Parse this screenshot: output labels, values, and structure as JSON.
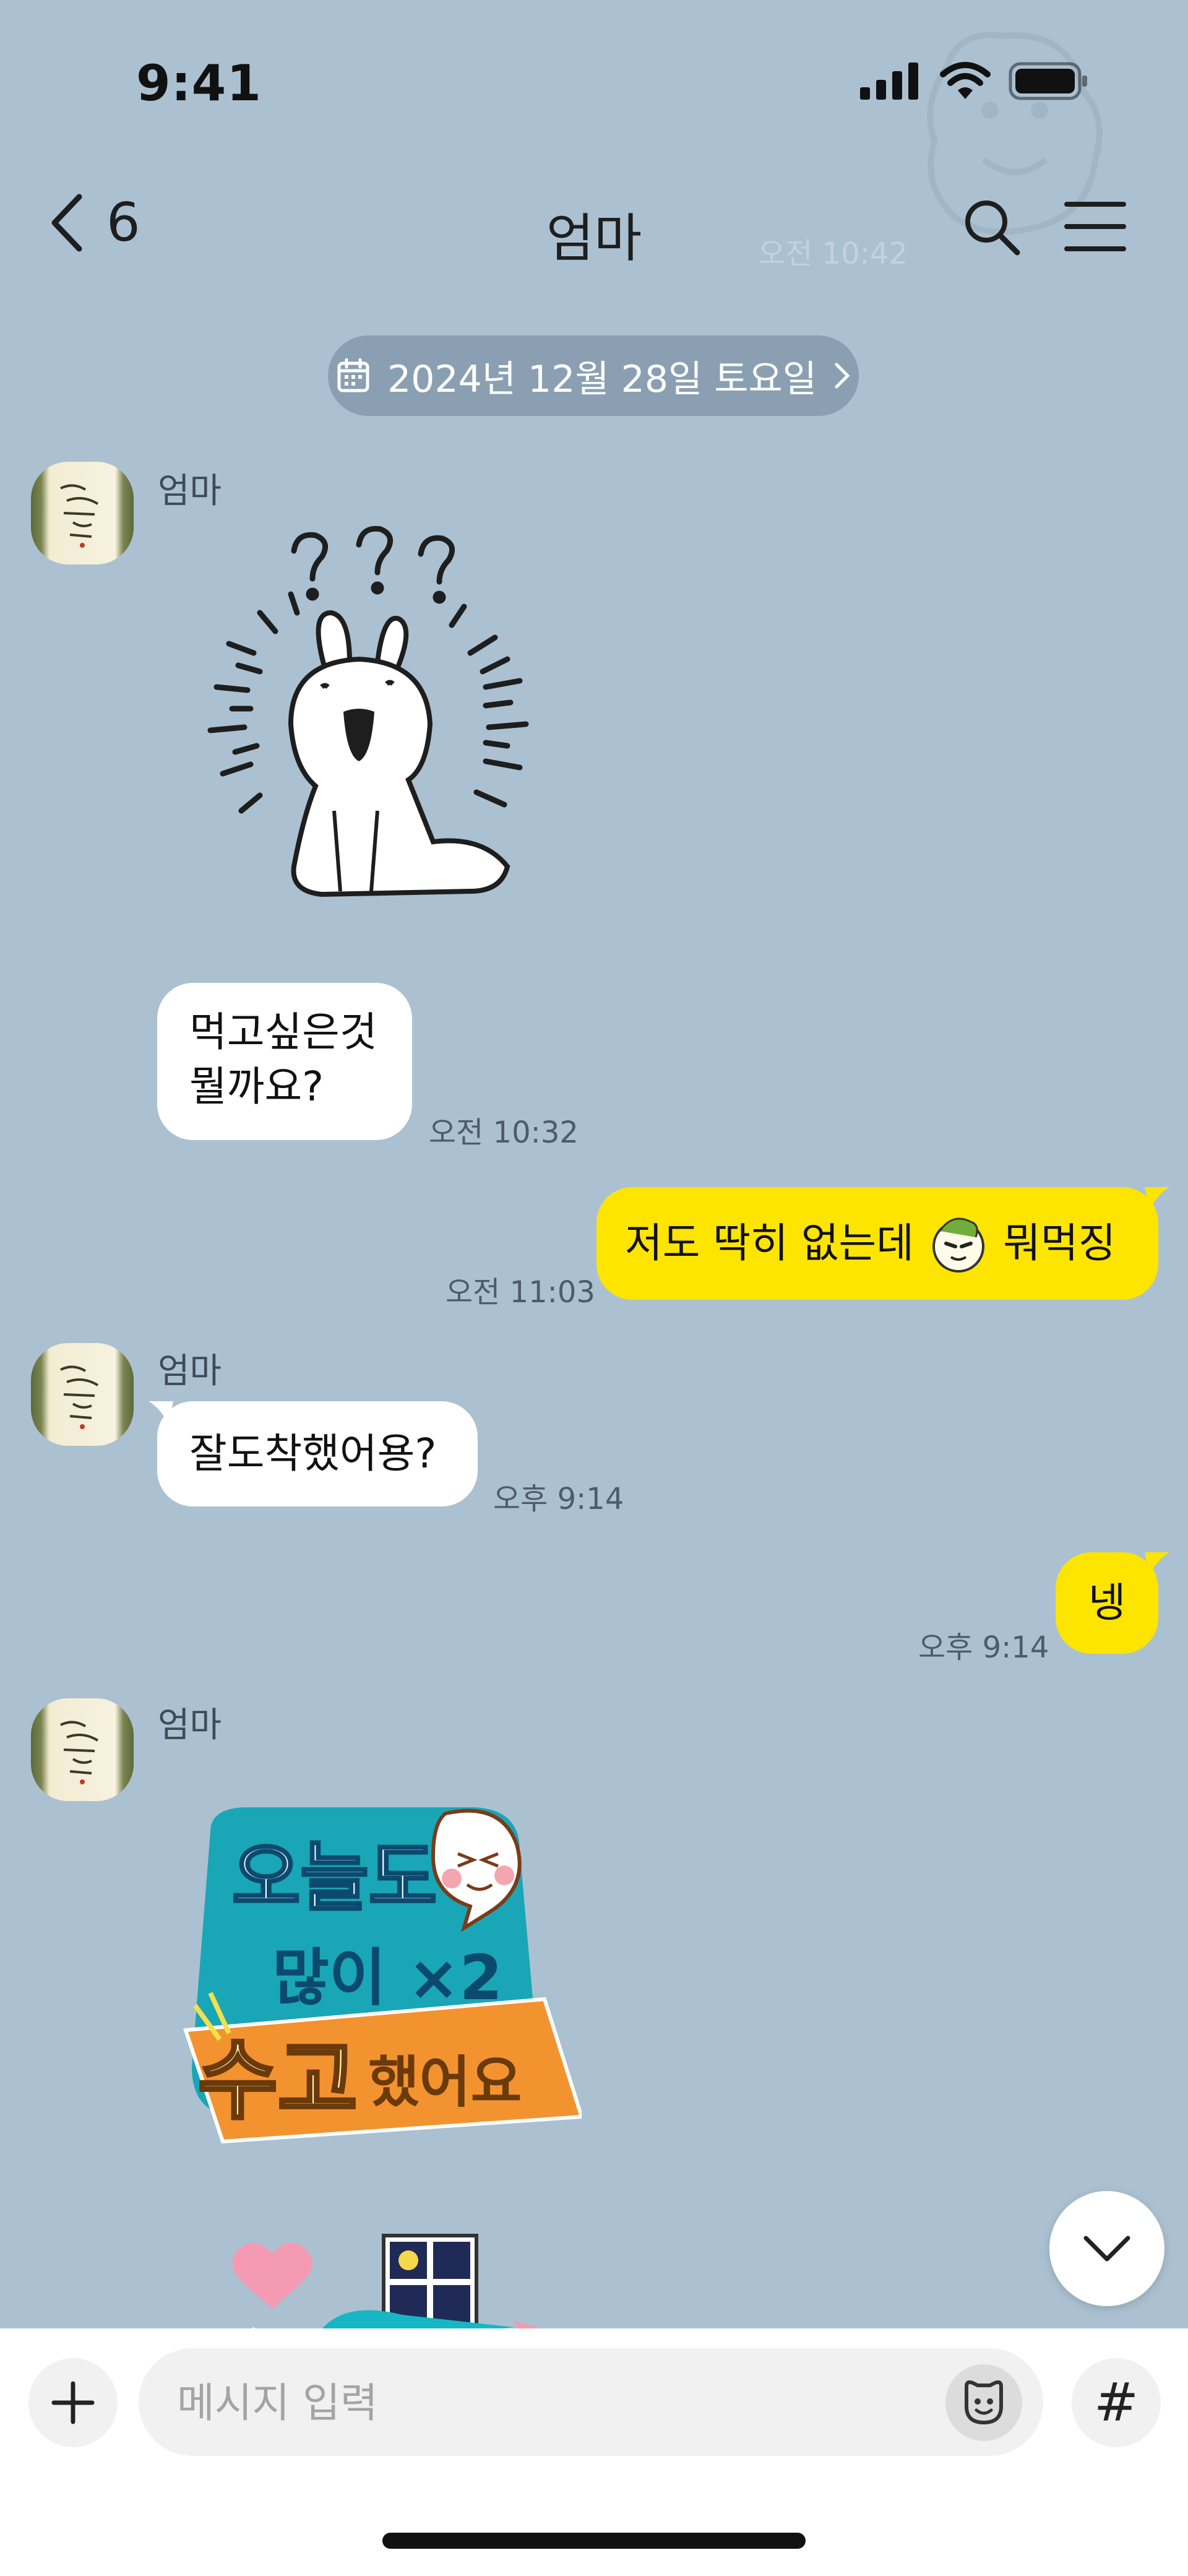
{
  "status": {
    "time": "9:41"
  },
  "header": {
    "back_count": "6",
    "title": "엄마",
    "ghost_time": "오전 10:42"
  },
  "date_separator": {
    "label": "2024년 12월 28일 토요일"
  },
  "messages": [
    {
      "type": "sender",
      "name": "엄마"
    },
    {
      "type": "text_in",
      "text_line1": "먹고싶은것",
      "text_line2": "뭘까요?",
      "time": "오전 10:32"
    },
    {
      "type": "text_out",
      "text_before": "저도 딱히 없는데",
      "text_after": "뭐먹징",
      "time": "오전 11:03"
    },
    {
      "type": "sender",
      "name": "엄마"
    },
    {
      "type": "text_in",
      "text": "잘도착했어용?",
      "time": "오후 9:14"
    },
    {
      "type": "text_out",
      "text": "넹",
      "time": "오후 9:14"
    },
    {
      "type": "sender",
      "name": "엄마"
    }
  ],
  "sticker2": {
    "line1": "오늘도",
    "line2": "많이 ×2",
    "line3a": "수고",
    "line3b": "했어요"
  },
  "input": {
    "placeholder": "메시지 입력",
    "hash_label": "#"
  },
  "colors": {
    "background": "#abc1d1",
    "outgoing_bubble": "#fee500",
    "incoming_bubble": "#ffffff",
    "date_pill": "#8aa0b2"
  },
  "icons": [
    "signal-icon",
    "wifi-icon",
    "battery-icon",
    "back-chevron-icon",
    "search-icon",
    "menu-icon",
    "calendar-icon",
    "chevron-right-icon",
    "chevron-down-icon",
    "plus-icon",
    "emoji-icon",
    "hash-icon"
  ]
}
